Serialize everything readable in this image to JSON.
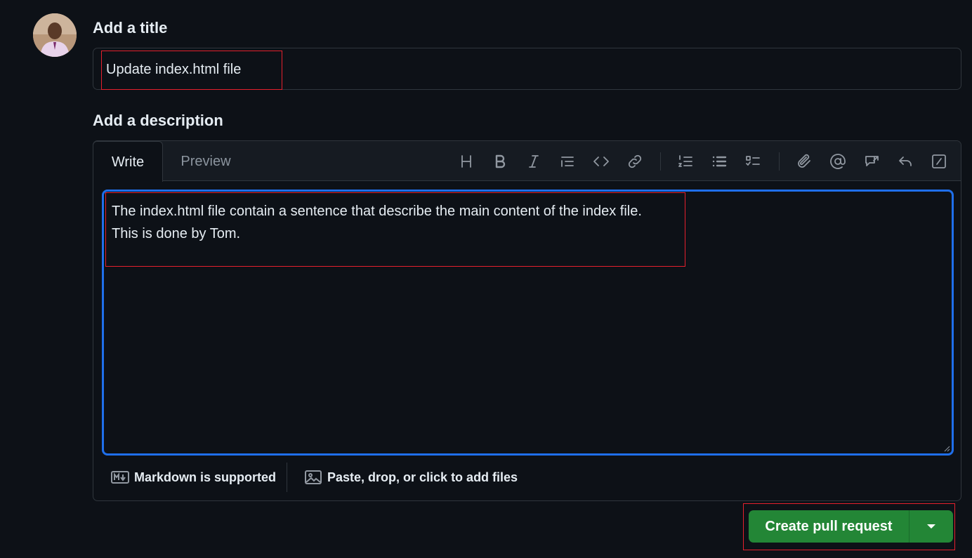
{
  "avatar": {
    "icon": "user-avatar"
  },
  "title_section": {
    "heading": "Add a title",
    "value": "Update index.html file"
  },
  "description_section": {
    "heading": "Add a description",
    "tabs": [
      {
        "label": "Write",
        "active": true
      },
      {
        "label": "Preview",
        "active": false
      }
    ],
    "toolbar": [
      "heading-icon",
      "bold-icon",
      "italic-icon",
      "quote-icon",
      "code-icon",
      "link-icon",
      "ordered-list-icon",
      "unordered-list-icon",
      "task-list-icon",
      "attach-icon",
      "mention-icon",
      "reference-icon",
      "undo-icon",
      "slash-command-icon"
    ],
    "text_lines": [
      "The index.html file contain a sentence that describe the main content of the index file.",
      "This is done by Tom."
    ],
    "footer": {
      "markdown": "Markdown is supported",
      "files": "Paste, drop, or click to add files"
    }
  },
  "actions": {
    "create_label": "Create pull request",
    "accent": "#238636",
    "focus_color": "#1f6feb",
    "highlight_color": "#e5202d"
  }
}
